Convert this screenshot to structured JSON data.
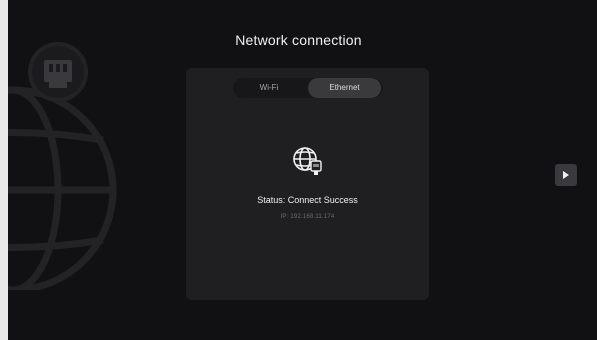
{
  "page": {
    "title": "Network connection"
  },
  "tabs": [
    {
      "label": "Wi-Fi",
      "selected": false
    },
    {
      "label": "Ethernet",
      "selected": true
    }
  ],
  "connection": {
    "icon": "globe-ethernet-icon",
    "status": "Status: Connect Success",
    "ip": "IP: 192.168.11.174"
  },
  "side": {
    "next_icon": "play-icon",
    "background_art_icon": "globe-ethernet-icon"
  },
  "colors": {
    "background": "#111113",
    "panel": "#1f1f21",
    "tab_selected": "#3a3a3d",
    "text_primary": "#f0f0f0",
    "text_muted": "#6e6e72"
  }
}
